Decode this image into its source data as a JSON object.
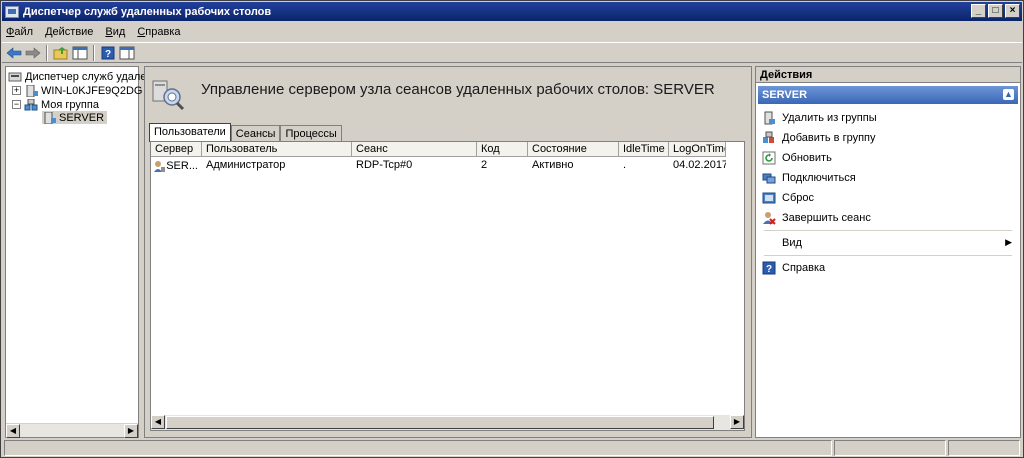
{
  "window": {
    "title": "Диспетчер служб удаленных рабочих столов"
  },
  "menu": [
    "Файл",
    "Действие",
    "Вид",
    "Справка"
  ],
  "tree": {
    "root": "Диспетчер служб удален",
    "server_node": "WIN-L0KJFE9Q2DG",
    "group": "Моя группа",
    "group_child": "SERVER"
  },
  "main": {
    "title": "Управление сервером узла сеансов удаленных рабочих столов: SERVER",
    "tabs": [
      "Пользователи",
      "Сеансы",
      "Процессы"
    ],
    "columns": [
      "Сервер",
      "Пользователь",
      "Сеанс",
      "Код",
      "Состояние",
      "IdleTime",
      "LogOnTime"
    ],
    "rows": [
      {
        "server": "SER...",
        "user": "Администратор",
        "session": "RDP-Tcp#0",
        "id": "2",
        "state": "Активно",
        "idle": ".",
        "logon": "04.02.2017 ..."
      }
    ]
  },
  "actions": {
    "title": "Действия",
    "section": "SERVER",
    "items": [
      "Удалить из группы",
      "Добавить в группу",
      "Обновить",
      "Подключиться",
      "Сброс",
      "Завершить сеанс",
      "Вид",
      "Справка"
    ]
  }
}
